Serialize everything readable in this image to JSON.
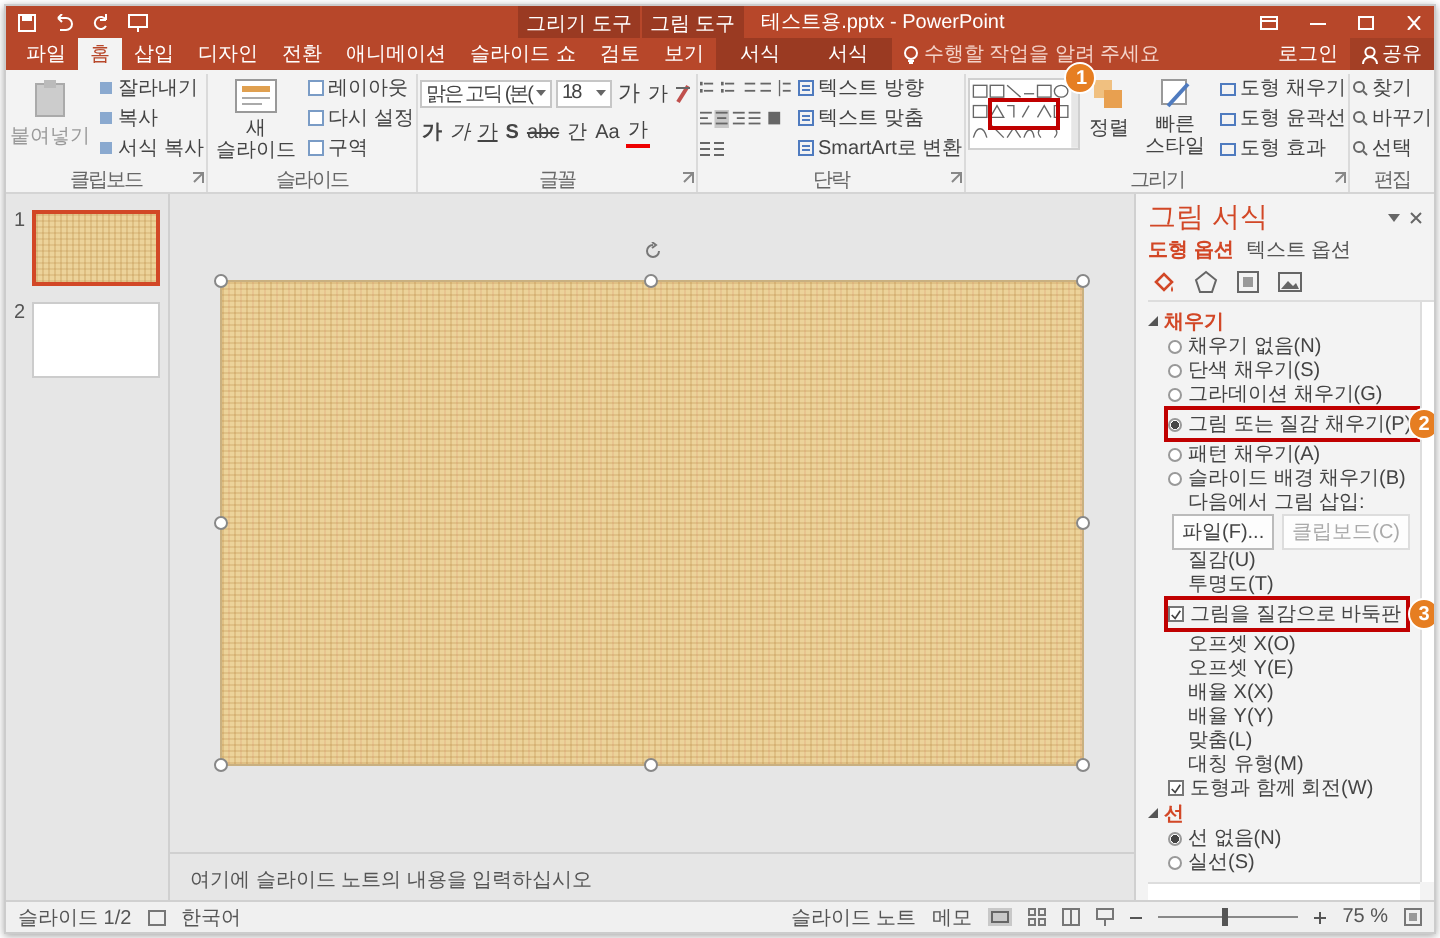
{
  "title_bar": {
    "title": "테스트용.pptx - PowerPoint",
    "context_groups": [
      "그리기 도구",
      "그림 도구"
    ]
  },
  "tabs": [
    {
      "label": "파일",
      "selected": false,
      "kind": "file"
    },
    {
      "label": "홈",
      "selected": true,
      "kind": "normal"
    },
    {
      "label": "삽입",
      "selected": false,
      "kind": "normal"
    },
    {
      "label": "디자인",
      "selected": false,
      "kind": "normal"
    },
    {
      "label": "전환",
      "selected": false,
      "kind": "normal"
    },
    {
      "label": "애니메이션",
      "selected": false,
      "kind": "normal"
    },
    {
      "label": "슬라이드 쇼",
      "selected": false,
      "kind": "normal"
    },
    {
      "label": "검토",
      "selected": false,
      "kind": "normal"
    },
    {
      "label": "보기",
      "selected": false,
      "kind": "normal"
    },
    {
      "label": "서식",
      "selected": false,
      "kind": "context"
    },
    {
      "label": "서식",
      "selected": false,
      "kind": "context"
    }
  ],
  "tell_me": {
    "placeholder": "수행할 작업을 알려 주세요"
  },
  "account": {
    "sign_in": "로그인",
    "share": "공유"
  },
  "ribbon": {
    "clipboard": {
      "label": "클립보드",
      "paste": "붙여넣기",
      "items": [
        "잘라내기",
        "복사",
        "서식 복사"
      ]
    },
    "slides": {
      "label": "슬라이드",
      "new_slide": "새 슬라이드",
      "items": [
        "레이아웃",
        "다시 설정",
        "구역"
      ]
    },
    "font": {
      "label": "글꼴",
      "family": "맑은 고딕 (본(",
      "size": "18",
      "size_buttons": [
        "가",
        "가"
      ],
      "format_buttons": [
        "가",
        "가",
        "가",
        "S",
        "abc",
        "간",
        "Aa",
        "가"
      ]
    },
    "paragraph": {
      "label": "단락",
      "text_items": [
        "텍스트 방향",
        "텍스트 맞춤",
        "SmartArt로 변환"
      ]
    },
    "drawing": {
      "label": "그리기",
      "arrange": "정렬",
      "quick_styles": "빠른 스타일",
      "items": [
        "도형 채우기",
        "도형 윤곽선",
        "도형 효과"
      ],
      "callout": "1"
    },
    "editing": {
      "label": "편집",
      "items": [
        "찾기",
        "바꾸기",
        "선택"
      ]
    }
  },
  "slides_panel": [
    {
      "number": "1",
      "selected": true,
      "kind": "texture"
    },
    {
      "number": "2",
      "selected": false,
      "kind": "blank"
    }
  ],
  "notes": {
    "placeholder": "여기에 슬라이드 노트의 내용을 입력하십시오"
  },
  "format_pane": {
    "title": "그림 서식",
    "tabs": [
      {
        "label": "도형 옵션",
        "selected": true
      },
      {
        "label": "텍스트 옵션",
        "selected": false
      }
    ],
    "sections": [
      {
        "title": "채우기",
        "expanded": true,
        "items": [
          {
            "kind": "radio",
            "label": "채우기 없음(N)",
            "selected": false
          },
          {
            "kind": "radio",
            "label": "단색 채우기(S)",
            "selected": false
          },
          {
            "kind": "radio",
            "label": "그라데이션 채우기(G)",
            "selected": false
          },
          {
            "kind": "radio",
            "label": "그림 또는 질감 채우기(P)",
            "selected": true,
            "callout": "2"
          },
          {
            "kind": "radio",
            "label": "패턴 채우기(A)",
            "selected": false
          },
          {
            "kind": "radio",
            "label": "슬라이드 배경 채우기(B)",
            "selected": false
          },
          {
            "kind": "label",
            "label": "다음에서 그림 삽입:"
          },
          {
            "kind": "buttons",
            "buttons": [
              {
                "label": "파일(F)...",
                "disabled": false
              },
              {
                "label": "클립보드(C)",
                "disabled": true
              }
            ]
          },
          {
            "kind": "label",
            "label": "질감(U)"
          },
          {
            "kind": "label",
            "label": "투명도(T)"
          },
          {
            "kind": "checkbox",
            "label": "그림을 질감으로 바둑판",
            "checked": true,
            "callout": "3"
          },
          {
            "kind": "label",
            "label": "오프셋 X(O)"
          },
          {
            "kind": "label",
            "label": "오프셋 Y(E)"
          },
          {
            "kind": "label",
            "label": "배율 X(X)"
          },
          {
            "kind": "label",
            "label": "배율 Y(Y)"
          },
          {
            "kind": "label",
            "label": "맞춤(L)"
          },
          {
            "kind": "label",
            "label": "대칭 유형(M)"
          },
          {
            "kind": "checkbox",
            "label": "도형과 함께 회전(W)",
            "checked": true
          }
        ]
      },
      {
        "title": "선",
        "expanded": true,
        "items": [
          {
            "kind": "radio",
            "label": "선 없음(N)",
            "selected": true
          },
          {
            "kind": "radio",
            "label": "실선(S)",
            "selected": false
          }
        ]
      }
    ]
  },
  "status_bar": {
    "slide": "슬라이드 1/2",
    "language": "한국어",
    "notes": "슬라이드 노트",
    "comments": "메모",
    "zoom": "75 %",
    "zoom_slider": {
      "level": 0.45
    }
  }
}
